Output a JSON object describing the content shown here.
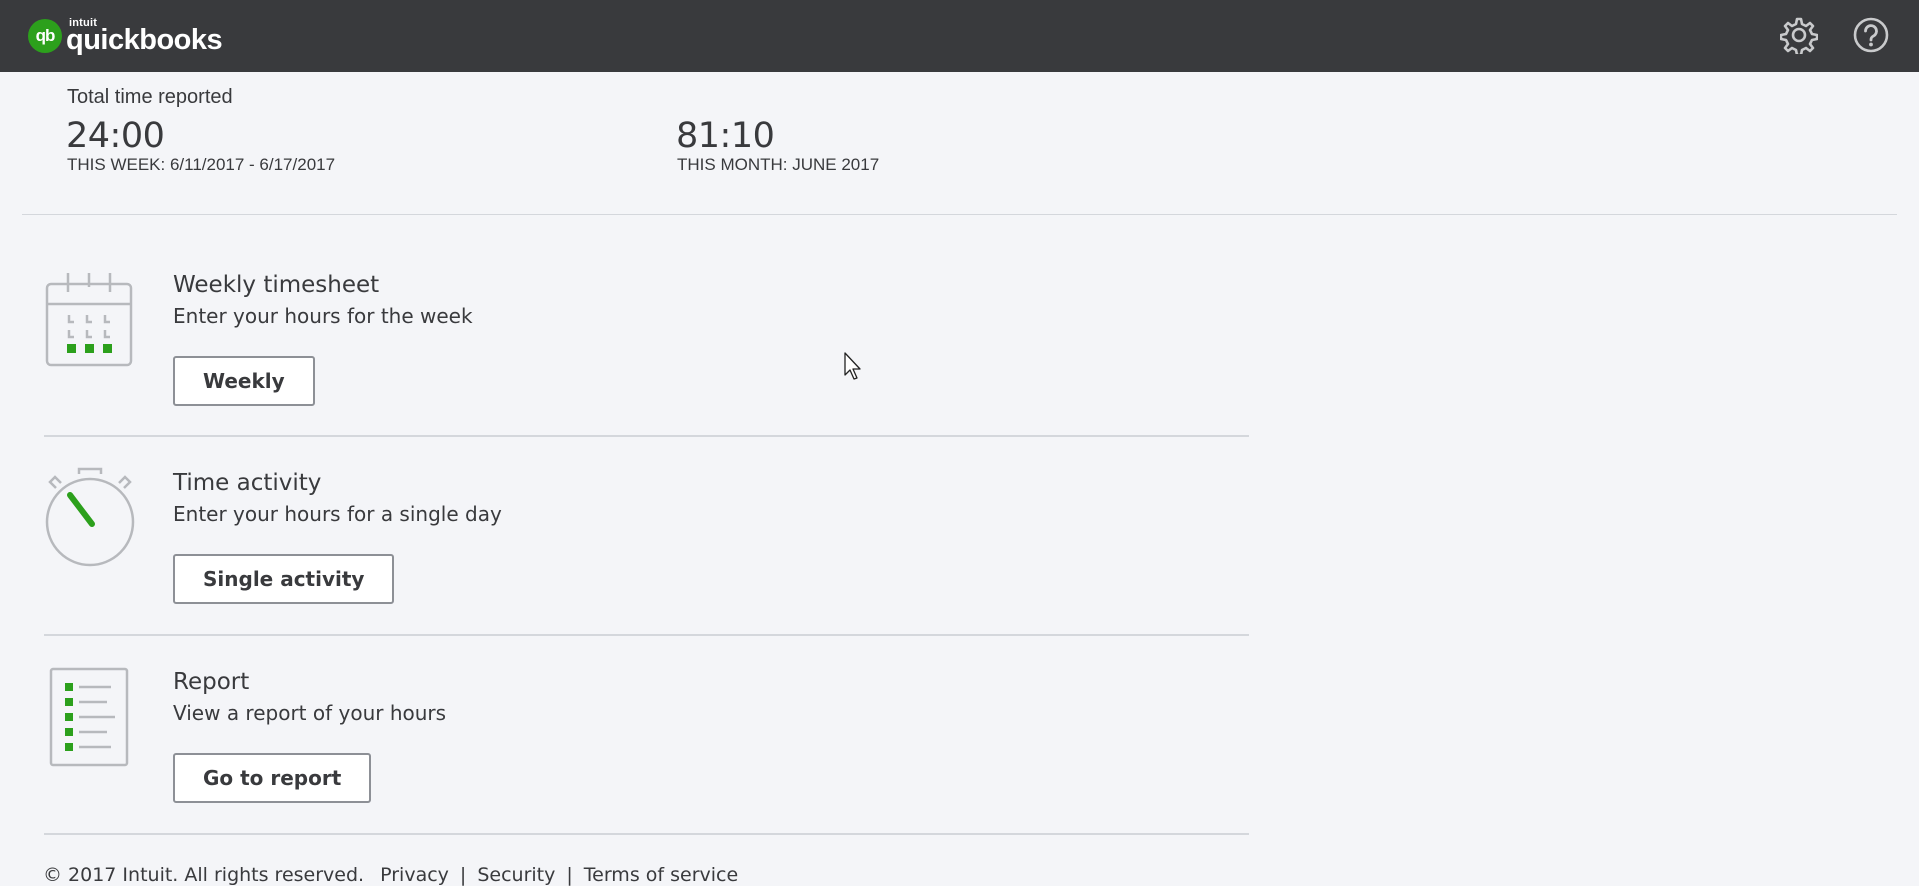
{
  "header": {
    "logo_intuit": "intuit",
    "logo_word": "quickbooks",
    "logo_badge": "qb",
    "settings_icon": "gear-icon",
    "help_icon": "help-icon"
  },
  "summary": {
    "label": "Total time reported",
    "week": {
      "value": "24:00",
      "caption": "THIS WEEK: 6/11/2017 - 6/17/2017"
    },
    "month": {
      "value": "81:10",
      "caption": "THIS MONTH: JUNE 2017"
    }
  },
  "sections": [
    {
      "icon": "calendar-icon",
      "title": "Weekly timesheet",
      "description": "Enter your hours for the week",
      "button": "Weekly"
    },
    {
      "icon": "stopwatch-icon",
      "title": "Time activity",
      "description": "Enter your hours for a single day",
      "button": "Single activity"
    },
    {
      "icon": "report-icon",
      "title": "Report",
      "description": "View a report of your hours",
      "button": "Go to report"
    }
  ],
  "footer": {
    "copyright": "© 2017 Intuit. All rights reserved.",
    "links": [
      "Privacy",
      "Security",
      "Terms of service"
    ]
  },
  "colors": {
    "header_bg": "#393a3d",
    "accent_green": "#2ca01c",
    "page_bg": "#f4f5f8"
  }
}
